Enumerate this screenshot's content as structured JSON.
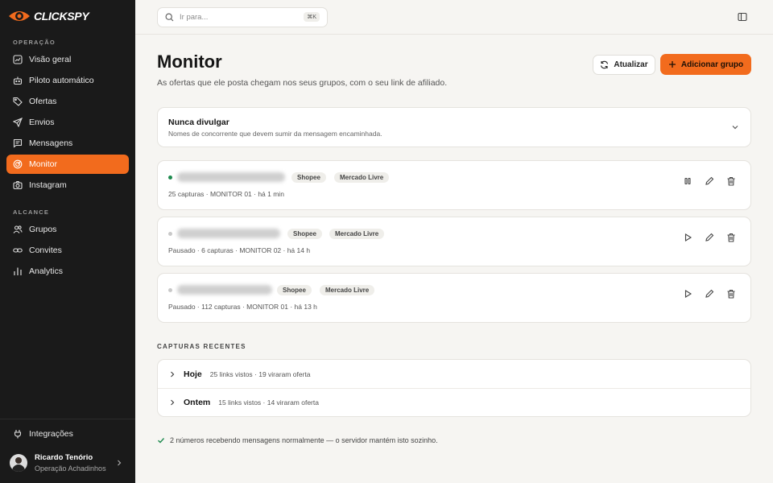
{
  "app": {
    "logo_text": "CLICKSPY",
    "brand_color": "#f26b1d"
  },
  "sidebar": {
    "section_operacao": "OPERAÇÃO",
    "section_alcance": "ALCANCE",
    "items": [
      {
        "label": "Visão geral",
        "icon": "chart-square-icon"
      },
      {
        "label": "Piloto automático",
        "icon": "robot-icon"
      },
      {
        "label": "Ofertas",
        "icon": "tag-icon"
      },
      {
        "label": "Envios",
        "icon": "send-icon"
      },
      {
        "label": "Mensagens",
        "icon": "message-icon"
      },
      {
        "label": "Monitor",
        "icon": "radar-icon",
        "active": true
      },
      {
        "label": "Instagram",
        "icon": "camera-icon"
      },
      {
        "label": "Grupos",
        "icon": "users-icon"
      },
      {
        "label": "Convites",
        "icon": "link-icon"
      },
      {
        "label": "Analytics",
        "icon": "bar-chart-icon"
      }
    ],
    "integrations": "Integrações",
    "user": {
      "name": "Ricardo Tenório",
      "org": "Operação Achadinhos"
    }
  },
  "search": {
    "placeholder": "Ir para...",
    "shortcut": "⌘K"
  },
  "header": {
    "title": "Monitor",
    "subtitle": "As ofertas que ele posta chegam nos seus grupos, com o seu link de afiliado.",
    "refresh_label": "Atualizar",
    "add_label": "Adicionar grupo"
  },
  "never_share": {
    "title": "Nunca divulgar",
    "subtitle": "Nomes de concorrente que devem sumir da mensagem encaminhada."
  },
  "monitors": [
    {
      "status": "active",
      "tags": [
        "Shopee",
        "Mercado Livre"
      ],
      "meta": "25 capturas · MONITOR 01 · há 1 min"
    },
    {
      "status": "paused",
      "tags": [
        "Shopee",
        "Mercado Livre"
      ],
      "meta": "Pausado · 6 capturas · MONITOR 02 · há 14 h"
    },
    {
      "status": "paused",
      "tags": [
        "Shopee",
        "Mercado Livre"
      ],
      "meta": "Pausado · 112 capturas · MONITOR 01 · há 13 h"
    }
  ],
  "recent": {
    "title": "CAPTURAS RECENTES",
    "rows": [
      {
        "day": "Hoje",
        "info": "25 links vistos · 19 viraram oferta"
      },
      {
        "day": "Ontem",
        "info": "15 links vistos · 14 viraram oferta"
      }
    ]
  },
  "status_text": "2 números recebendo mensagens normalmente — o servidor mantém isto sozinho."
}
